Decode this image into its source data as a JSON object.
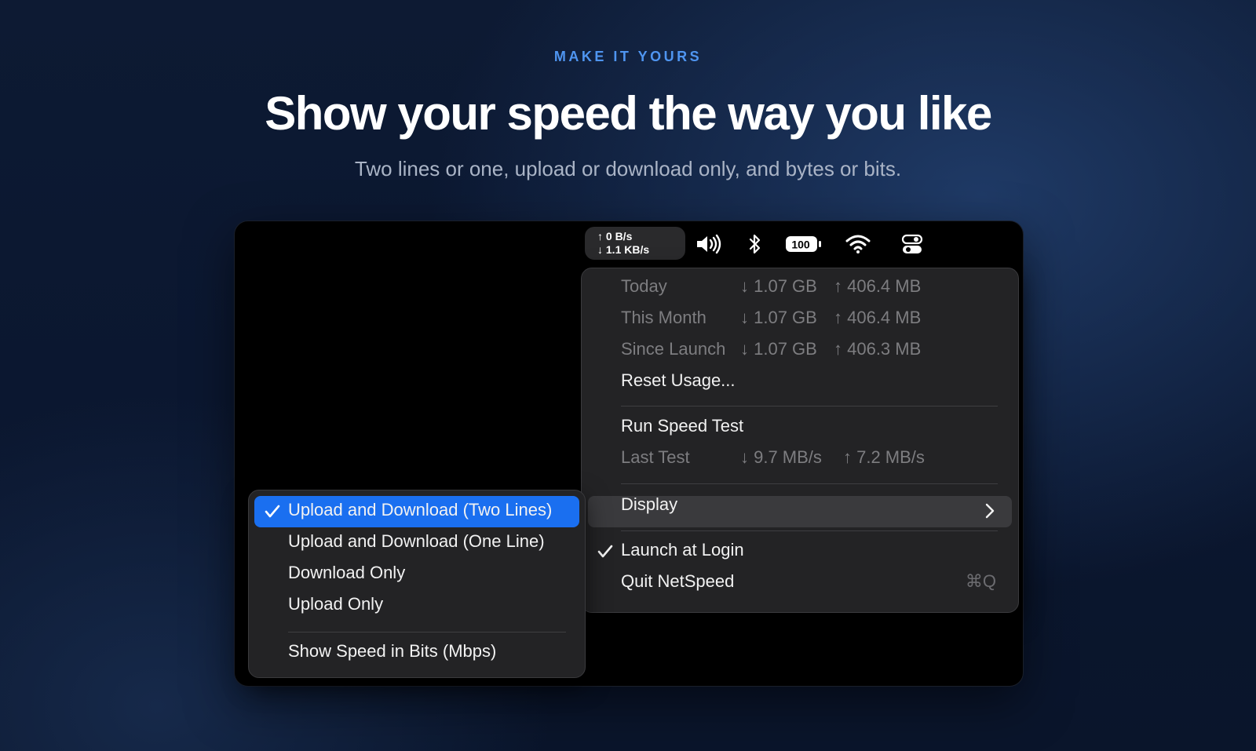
{
  "hero": {
    "eyebrow": "MAKE IT YOURS",
    "title": "Show your speed the way you like",
    "subtitle": "Two lines or one, upload or download only, and bytes or bits."
  },
  "menubar": {
    "upload_speed": "↑ 0 B/s",
    "download_speed": "↓ 1.1 KB/s",
    "battery_level": "100",
    "icons": [
      "speaker-icon",
      "bluetooth-icon",
      "battery-icon",
      "wifi-icon",
      "control-center-icon"
    ]
  },
  "menu": {
    "usage": [
      {
        "label": "Today",
        "down": "↓ 1.07 GB",
        "up": "↑ 406.4 MB"
      },
      {
        "label": "This Month",
        "down": "↓ 1.07 GB",
        "up": "↑ 406.4 MB"
      },
      {
        "label": "Since Launch",
        "down": "↓ 1.07 GB",
        "up": "↑ 406.3 MB"
      }
    ],
    "reset_label": "Reset Usage...",
    "run_test_label": "Run Speed Test",
    "last_test": {
      "label": "Last Test",
      "down": "↓ 9.7 MB/s",
      "up": "↑ 7.2 MB/s"
    },
    "display_label": "Display",
    "launch_at_login_label": "Launch at Login",
    "launch_at_login_checked": true,
    "quit_label": "Quit NetSpeed",
    "quit_shortcut": "⌘Q"
  },
  "submenu": {
    "items": [
      {
        "label": "Upload and Download (Two Lines)",
        "checked": true
      },
      {
        "label": "Upload and Download (One Line)",
        "checked": false
      },
      {
        "label": "Download Only",
        "checked": false
      },
      {
        "label": "Upload Only",
        "checked": false
      }
    ],
    "bits_label": "Show Speed in Bits (Mbps)"
  },
  "colors": {
    "accent": "#1a6ff0",
    "eyebrow": "#4f95f0"
  }
}
